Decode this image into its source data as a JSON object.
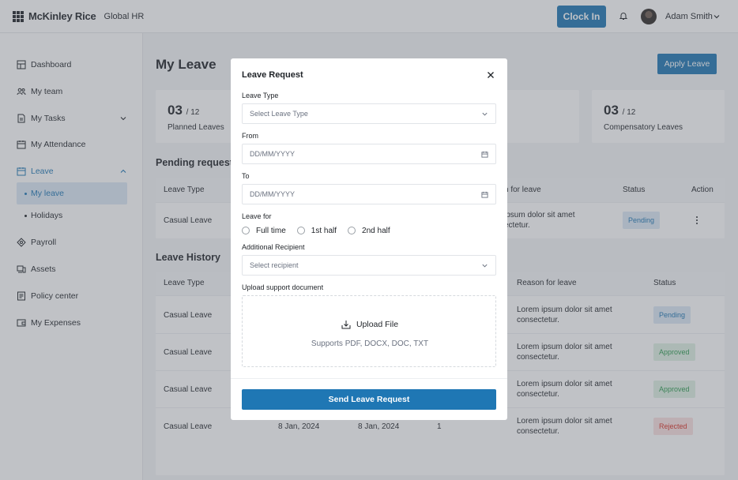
{
  "header": {
    "brand": "McKinley Rice",
    "sub": "Global HR",
    "clock_in": "Clock In",
    "user_name": "Adam Smith"
  },
  "sidebar": {
    "items": [
      {
        "label": "Dashboard",
        "icon": "dashboard-icon"
      },
      {
        "label": "My team",
        "icon": "team-icon"
      },
      {
        "label": "My Tasks",
        "icon": "tasks-icon"
      },
      {
        "label": "My Attendance",
        "icon": "calendar-icon"
      },
      {
        "label": "Leave",
        "icon": "calendar-icon"
      },
      {
        "label": "Payroll",
        "icon": "payroll-icon"
      },
      {
        "label": "Assets",
        "icon": "assets-icon"
      },
      {
        "label": "Policy center",
        "icon": "policy-icon"
      },
      {
        "label": "My Expenses",
        "icon": "wallet-icon"
      }
    ],
    "leave_sub": [
      "My leave",
      "Holidays"
    ]
  },
  "page": {
    "title": "My Leave",
    "apply_button": "Apply Leave",
    "stats": [
      {
        "num": "03",
        "den": "/ 12",
        "label": "Planned Leaves"
      },
      {
        "num": "03",
        "den": "/ 12",
        "label": "Compensatory Leaves"
      }
    ]
  },
  "pending": {
    "title": "Pending request",
    "headers": {
      "type": "Leave Type",
      "reason": "n for leave",
      "status": "Status",
      "action": "Action"
    },
    "rows": [
      {
        "type": "Casual Leave",
        "reason_1": "ipsum dolor sit amet",
        "reason_2": "ectetur.",
        "status": "Pending"
      }
    ]
  },
  "history": {
    "title": "Leave History",
    "headers": {
      "type": "Leave Type",
      "reason": "Reason for leave",
      "status": "Status"
    },
    "rows": [
      {
        "type": "Casual Leave",
        "from": "",
        "to": "",
        "days": "",
        "reason_1": "Lorem ipsum dolor sit amet",
        "reason_2": "consectetur.",
        "status": "Pending"
      },
      {
        "type": "Casual Leave",
        "from": "",
        "to": "",
        "days": "",
        "reason_1": "Lorem ipsum dolor sit amet",
        "reason_2": "consectetur.",
        "status": "Approved"
      },
      {
        "type": "Casual Leave",
        "from": "",
        "to": "",
        "days": "",
        "reason_1": "Lorem ipsum dolor sit amet",
        "reason_2": "consectetur.",
        "status": "Approved"
      },
      {
        "type": "Casual Leave",
        "from": "8 Jan, 2024",
        "to": "8 Jan, 2024",
        "days": "1",
        "reason_1": "Lorem ipsum dolor sit amet",
        "reason_2": "consectetur.",
        "status": "Rejected"
      }
    ]
  },
  "modal": {
    "title": "Leave Request",
    "leave_type_label": "Leave Type",
    "leave_type_placeholder": "Select Leave Type",
    "from_label": "From",
    "from_placeholder": "DD/MM/YYYY",
    "to_label": "To",
    "to_placeholder": "DD/MM/YYYY",
    "leave_for_label": "Leave for",
    "options": [
      "Full time",
      "1st half",
      "2nd half"
    ],
    "recipient_label": "Additional Recipient",
    "recipient_placeholder": "Select recipient",
    "upload_label": "Upload support document",
    "upload_title": "Upload File",
    "upload_sub": "Supports PDF, DOCX, DOC, TXT",
    "send": "Send Leave Request"
  },
  "colors": {
    "accent": "#1f77b4",
    "pending": "#1f77b4",
    "approved": "#2e9b51",
    "rejected": "#d93025"
  }
}
